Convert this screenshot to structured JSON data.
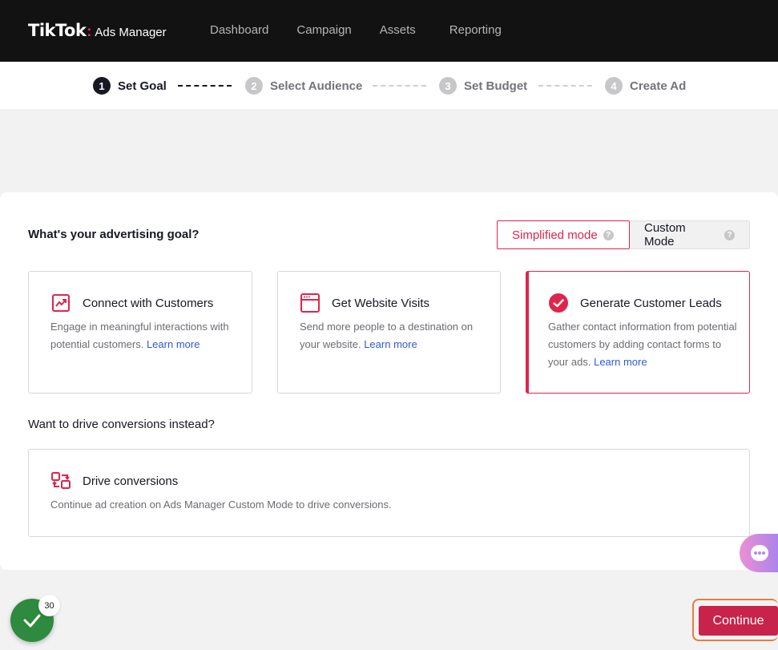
{
  "header": {
    "logo_main": "TikTok",
    "logo_dot": ":",
    "logo_sub": "Ads Manager",
    "nav": [
      "Dashboard",
      "Campaign",
      "Assets",
      "Reporting"
    ]
  },
  "stepper": {
    "steps": [
      {
        "num": "1",
        "label": "Set Goal"
      },
      {
        "num": "2",
        "label": "Select Audience"
      },
      {
        "num": "3",
        "label": "Set Budget"
      },
      {
        "num": "4",
        "label": "Create Ad"
      }
    ],
    "active_step": 1
  },
  "goal": {
    "question": "What's your advertising goal?",
    "modes": {
      "simplified": "Simplified mode",
      "custom": "Custom Mode",
      "help_glyph": "?"
    },
    "cards": [
      {
        "title": "Connect with Customers",
        "desc": "Engage in meaningful interactions with potential customers.",
        "learn": "Learn more",
        "icon": "trending-chart-icon",
        "selected": false
      },
      {
        "title": "Get Website Visits",
        "desc": "Send more people to a destination on your website.",
        "learn": "Learn more",
        "icon": "browser-window-icon",
        "selected": false
      },
      {
        "title": "Generate Customer Leads",
        "desc": "Gather contact information from potential customers by adding contact forms to your ads.",
        "learn": "Learn more",
        "icon": "check-circle-icon",
        "selected": true
      }
    ]
  },
  "drive": {
    "question": "Want to drive conversions instead?",
    "title": "Drive conversions",
    "desc": "Continue ad creation on Ads Manager Custom Mode to drive conversions.",
    "icon": "conversion-swap-icon"
  },
  "footer": {
    "checklist_count": "30",
    "continue_label": "Continue"
  },
  "colors": {
    "accent": "#e0244b",
    "continue_bg": "#c8234a",
    "topbar_bg": "#121212",
    "checklist_green": "#2e8a3e",
    "link": "#2e5bd6"
  }
}
